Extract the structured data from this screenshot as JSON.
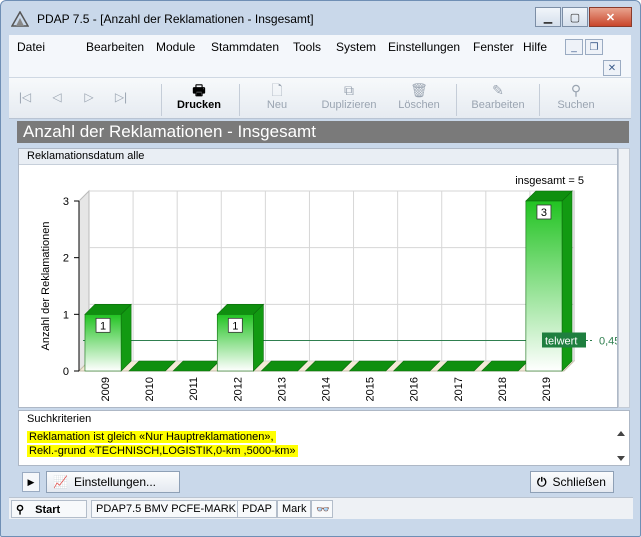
{
  "window": {
    "title": "PDAP 7.5 - [Anzahl der Reklamationen - Insgesamt]"
  },
  "menu": {
    "items": [
      "Datei",
      "Bearbeiten",
      "Module",
      "Stammdaten",
      "Tools",
      "System",
      "Einstellungen",
      "Fenster",
      "Hilfe"
    ]
  },
  "toolbar": {
    "print_label": "Drucken",
    "new_label": "Neu",
    "duplicate_label": "Duplizieren",
    "delete_label": "Löschen",
    "edit_label": "Bearbeiten",
    "search_label": "Suchen"
  },
  "page": {
    "title": "Anzahl der Reklamationen - Insgesamt"
  },
  "chart_panel": {
    "header": "Reklamationsdatum alle"
  },
  "chart_data": {
    "type": "bar",
    "categories": [
      "2009",
      "2010",
      "2011",
      "2012",
      "2013",
      "2014",
      "2015",
      "2016",
      "2017",
      "2018",
      "2019"
    ],
    "values": [
      1,
      0,
      0,
      1,
      0,
      0,
      0,
      0,
      0,
      0,
      3
    ],
    "data_labels": [
      "1",
      "",
      "",
      "1",
      "",
      "",
      "",
      "",
      "",
      "",
      "3"
    ],
    "ylabel": "Anzahl der Reklamationen",
    "ylim": [
      0,
      3
    ],
    "yticks": [
      "0",
      "1",
      "2",
      "3"
    ],
    "total_label": "insgesamt = 5",
    "average_label": "telwert",
    "average_value": 0.45,
    "average_value_label": "0,45",
    "bar_color": "#22c322",
    "grid": true
  },
  "criteria": {
    "label": "Suchkriterien",
    "lines": [
      "Reklamation ist gleich  «Nur Hauptreklamationen»,",
      "Rekl.-grund  «TECHNISCH,LOGISTIK,0-km ,5000-km»"
    ],
    "highlight_color": "#ffff00"
  },
  "bottom": {
    "settings_label": "Einstellungen...",
    "close_label": "Schließen"
  },
  "status": {
    "start": "Start",
    "cells": [
      "PDAP7.5 BMV PCFE-MARK",
      "PDAP",
      "Mark"
    ]
  }
}
